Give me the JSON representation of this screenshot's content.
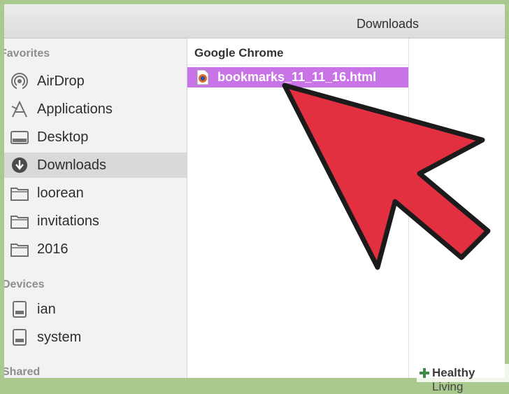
{
  "window": {
    "title": "Downloads"
  },
  "sidebar": {
    "favorites_header": "Favorites",
    "favorites": [
      {
        "label": "AirDrop",
        "icon": "airdrop-icon"
      },
      {
        "label": "Applications",
        "icon": "applications-icon"
      },
      {
        "label": "Desktop",
        "icon": "desktop-icon"
      },
      {
        "label": "Downloads",
        "icon": "downloads-icon",
        "selected": true
      },
      {
        "label": "loorean",
        "icon": "folder-icon"
      },
      {
        "label": "invitations",
        "icon": "folder-icon"
      },
      {
        "label": "2016",
        "icon": "folder-icon"
      }
    ],
    "devices_header": "Devices",
    "devices": [
      {
        "label": "ian",
        "icon": "drive-icon"
      },
      {
        "label": "system",
        "icon": "drive-icon"
      }
    ],
    "shared_header": "Shared"
  },
  "columns": {
    "first_header": "Google Chrome",
    "selected_file": {
      "name": "bookmarks_11_11_16.html",
      "icon": "firefox-file-icon"
    }
  },
  "colors": {
    "selection": "#c874e6",
    "arrow": "#e23040"
  },
  "watermark": {
    "bold": "Healthy",
    "rest": " Living"
  }
}
